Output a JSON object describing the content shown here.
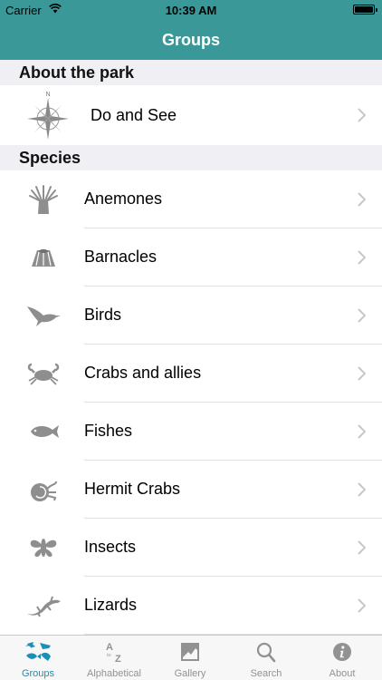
{
  "status_bar": {
    "carrier": "Carrier",
    "time": "10:39 AM"
  },
  "nav": {
    "title": "Groups"
  },
  "sections": {
    "about": {
      "header": "About the park",
      "items": [
        {
          "label": "Do and See",
          "icon": "compass-rose-icon"
        }
      ]
    },
    "species": {
      "header": "Species",
      "items": [
        {
          "label": "Anemones",
          "icon": "anemone-icon"
        },
        {
          "label": "Barnacles",
          "icon": "barnacle-icon"
        },
        {
          "label": "Birds",
          "icon": "bird-icon"
        },
        {
          "label": "Crabs and allies",
          "icon": "crab-icon"
        },
        {
          "label": "Fishes",
          "icon": "fish-icon"
        },
        {
          "label": "Hermit Crabs",
          "icon": "hermit-crab-icon"
        },
        {
          "label": "Insects",
          "icon": "insect-icon"
        },
        {
          "label": "Lizards",
          "icon": "lizard-icon"
        }
      ]
    }
  },
  "tabs": [
    {
      "label": "Groups",
      "icon": "groups-icon",
      "active": true
    },
    {
      "label": "Alphabetical",
      "icon": "a-to-z-icon",
      "active": false
    },
    {
      "label": "Gallery",
      "icon": "gallery-icon",
      "active": false
    },
    {
      "label": "Search",
      "icon": "search-icon",
      "active": false
    },
    {
      "label": "About",
      "icon": "info-icon",
      "active": false
    }
  ],
  "colors": {
    "brand": "#3b9899",
    "tab_active": "#1b8fb7",
    "tab_inactive": "#929292",
    "icon_gray": "#8e8e8e"
  }
}
